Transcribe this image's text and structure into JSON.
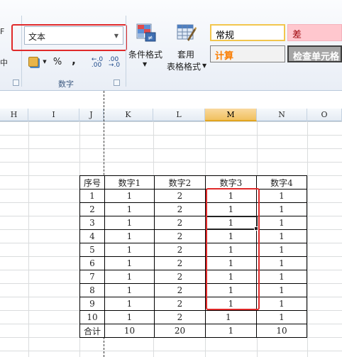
{
  "ribbon": {
    "edge_glyph_top": "F",
    "edge_glyph_middle": "中",
    "number_format": {
      "value": "文本"
    },
    "number_buttons": {
      "percent": "%",
      "comma": ",",
      "increase_decimal": "←.0\n.00",
      "decrease_decimal": ".00\n→.0"
    },
    "number_group_title": "数字",
    "conditional_format_label": "条件格式",
    "table_format_label_1": "套用",
    "table_format_label_2": "表格格式",
    "styles": {
      "normal": "常规",
      "bad": "差",
      "calc": "计算",
      "check": "检查单元格"
    }
  },
  "sheet": {
    "columns": [
      {
        "name": "H"
      },
      {
        "name": "I"
      },
      {
        "name": "J"
      },
      {
        "name": "K"
      },
      {
        "name": "L"
      },
      {
        "name": "M",
        "active": true
      },
      {
        "name": "N"
      },
      {
        "name": "O"
      }
    ],
    "table": {
      "headers": [
        "序号",
        "数字1",
        "数字2",
        "数字3",
        "数字4"
      ],
      "rows": [
        [
          "1",
          "1",
          "2",
          "1",
          "1"
        ],
        [
          "2",
          "1",
          "2",
          "1",
          "1"
        ],
        [
          "3",
          "1",
          "2",
          "1",
          "1"
        ],
        [
          "4",
          "1",
          "2",
          "1",
          "1"
        ],
        [
          "5",
          "1",
          "2",
          "1",
          "1"
        ],
        [
          "6",
          "1",
          "2",
          "1",
          "1"
        ],
        [
          "7",
          "1",
          "2",
          "1",
          "1"
        ],
        [
          "8",
          "1",
          "2",
          "1",
          "1"
        ],
        [
          "9",
          "1",
          "2",
          "1",
          "1"
        ],
        [
          "10",
          "1",
          "2",
          "1",
          "1"
        ]
      ],
      "total": [
        "合计",
        "10",
        "20",
        "1",
        "10"
      ]
    }
  },
  "colors": {
    "highlight": "#e02a2a",
    "active_column": "#f1c15f"
  }
}
